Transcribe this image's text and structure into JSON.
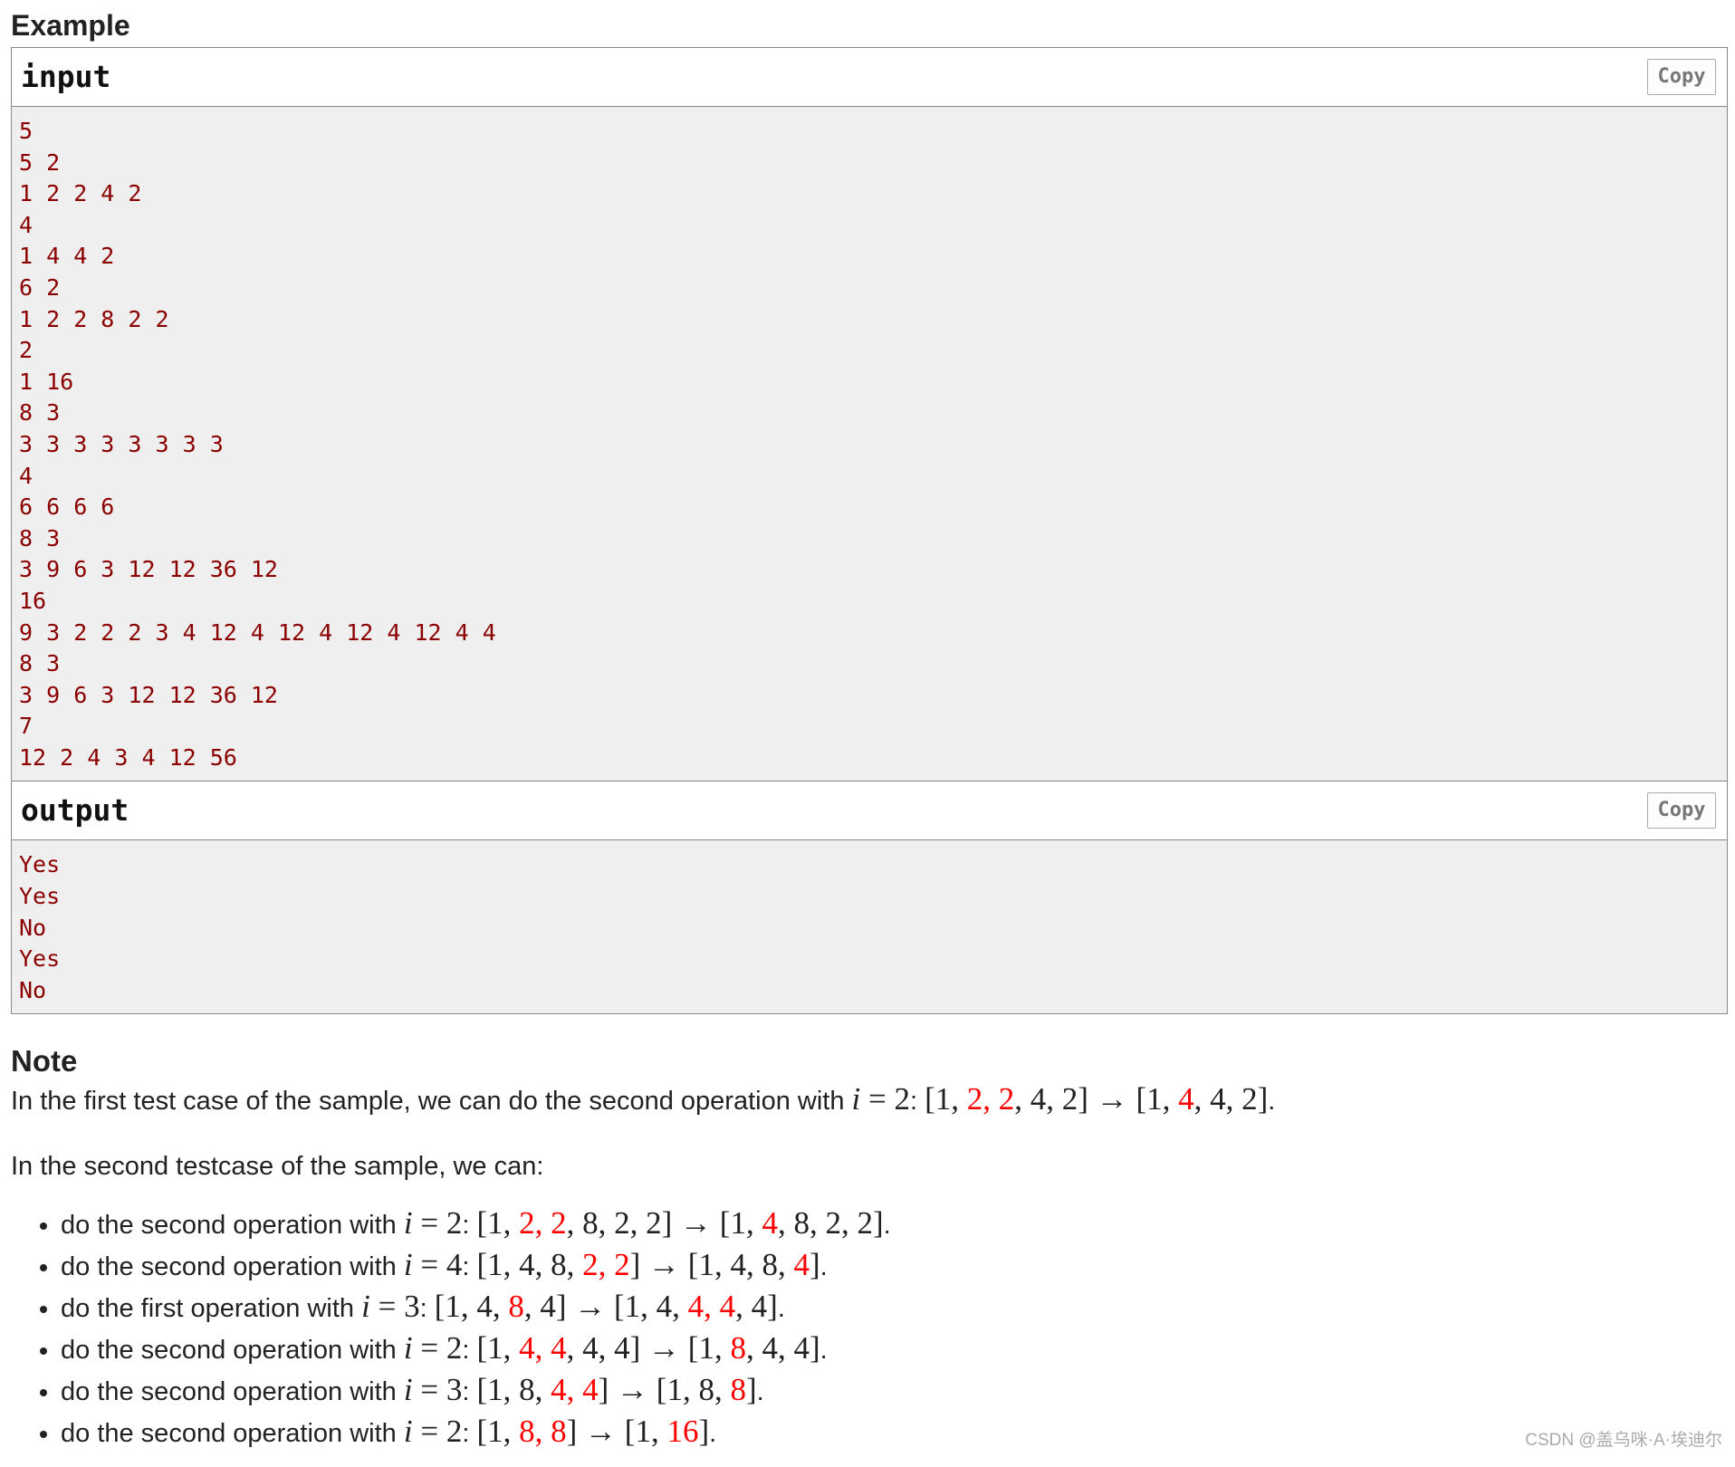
{
  "example_title": "Example",
  "input_label": "input",
  "output_label": "output",
  "copy_label": "Copy",
  "input_lines": [
    "5",
    "5 2",
    "1 2 2 4 2",
    "4",
    "1 4 4 2",
    "6 2",
    "1 2 2 8 2 2",
    "2",
    "1 16",
    "8 3",
    "3 3 3 3 3 3 3 3",
    "4",
    "6 6 6 6",
    "8 3",
    "3 9 6 3 12 12 36 12",
    "16",
    "9 3 2 2 2 3 4 12 4 12 4 12 4 12 4 4",
    "8 3",
    "3 9 6 3 12 12 36 12",
    "7",
    "12 2 4 3 4 12 56"
  ],
  "output_lines": [
    "Yes",
    "Yes",
    "No",
    "Yes",
    "No"
  ],
  "note": {
    "title": "Note",
    "para1_text": "In the first test case of the sample, we can do the second operation with ",
    "para1_i": "2",
    "para1_before": [
      "1",
      "2",
      "2",
      "4",
      "2"
    ],
    "para1_before_red": [
      1,
      2
    ],
    "para1_after": [
      "1",
      "4",
      "4",
      "2"
    ],
    "para1_after_red": [
      1
    ],
    "para2": "In the second testcase of the sample, we can:",
    "operations": [
      {
        "text": "do the second operation with ",
        "i": "2",
        "before": [
          "1",
          "2",
          "2",
          "8",
          "2",
          "2"
        ],
        "before_red": [
          1,
          2
        ],
        "after": [
          "1",
          "4",
          "8",
          "2",
          "2"
        ],
        "after_red": [
          1
        ]
      },
      {
        "text": "do the second operation with ",
        "i": "4",
        "before": [
          "1",
          "4",
          "8",
          "2",
          "2"
        ],
        "before_red": [
          3,
          4
        ],
        "after": [
          "1",
          "4",
          "8",
          "4"
        ],
        "after_red": [
          3
        ]
      },
      {
        "text": "do the first operation with ",
        "i": "3",
        "before": [
          "1",
          "4",
          "8",
          "4"
        ],
        "before_red": [
          2
        ],
        "after": [
          "1",
          "4",
          "4",
          "4",
          "4"
        ],
        "after_red": [
          2,
          3
        ]
      },
      {
        "text": "do the second operation with ",
        "i": "2",
        "before": [
          "1",
          "4",
          "4",
          "4",
          "4"
        ],
        "before_red": [
          1,
          2
        ],
        "after": [
          "1",
          "8",
          "4",
          "4"
        ],
        "after_red": [
          1
        ]
      },
      {
        "text": "do the second operation with ",
        "i": "3",
        "before": [
          "1",
          "8",
          "4",
          "4"
        ],
        "before_red": [
          2,
          3
        ],
        "after": [
          "1",
          "8",
          "8"
        ],
        "after_red": [
          2
        ]
      },
      {
        "text": "do the second operation with ",
        "i": "2",
        "before": [
          "1",
          "8",
          "8"
        ],
        "before_red": [
          1,
          2
        ],
        "after": [
          "1",
          "16"
        ],
        "after_red": [
          1
        ]
      }
    ]
  },
  "watermark": "CSDN @盖乌咪·A·埃迪尔",
  "colors": {
    "highlight": "#ff0000",
    "sample_text": "#8b0000",
    "sample_bg": "#efefef"
  }
}
